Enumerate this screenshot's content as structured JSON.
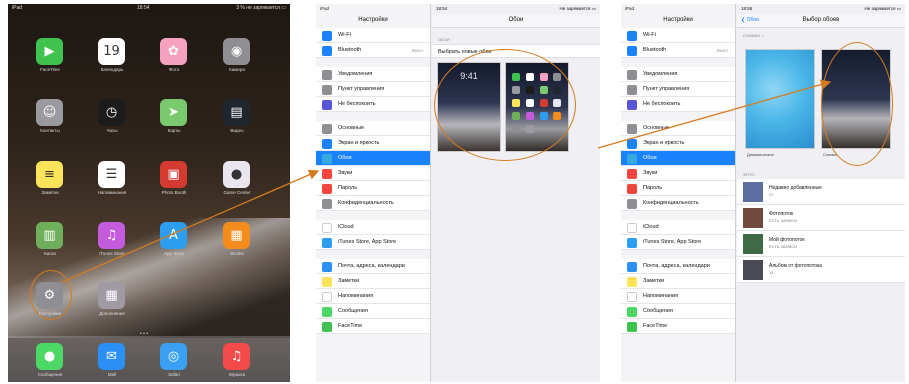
{
  "colors": {
    "accent": "#1a82fb",
    "annotation": "#d57b1e",
    "settings_bg": "#efeff4"
  },
  "home": {
    "status": {
      "left": "iPad",
      "center": "18:54",
      "right": "3 % не заряжается ▭"
    },
    "apps": [
      {
        "label": "FaceTime",
        "icon": "facetime-icon",
        "color": "#3fc24e",
        "glyph": "▶"
      },
      {
        "label": "Календарь",
        "icon": "calendar-icon",
        "color": "#ffffff",
        "glyph": "19"
      },
      {
        "label": "Фото",
        "icon": "photos-icon",
        "color": "#f6a1c0",
        "glyph": "✿"
      },
      {
        "label": "Камера",
        "icon": "camera-icon",
        "color": "#8e8e93",
        "glyph": "◉"
      },
      {
        "label": "Контакты",
        "icon": "contacts-icon",
        "color": "#9a9aa0",
        "glyph": "☺"
      },
      {
        "label": "Часы",
        "icon": "clock-icon",
        "color": "#1c1c1c",
        "glyph": "◷"
      },
      {
        "label": "Карты",
        "icon": "maps-icon",
        "color": "#7bc96f",
        "glyph": "➤"
      },
      {
        "label": "Видео",
        "icon": "videos-icon",
        "color": "#20262e",
        "glyph": "▤"
      },
      {
        "label": "Заметки",
        "icon": "notes-icon",
        "color": "#fbe45a",
        "glyph": "≡"
      },
      {
        "label": "Напоминания",
        "icon": "reminders-icon",
        "color": "#ffffff",
        "glyph": "☰"
      },
      {
        "label": "Photo Booth",
        "icon": "photobooth-icon",
        "color": "#d43a2f",
        "glyph": "▣"
      },
      {
        "label": "Game Center",
        "icon": "gamecenter-icon",
        "color": "#e9e6ef",
        "glyph": "●"
      },
      {
        "label": "Киоск",
        "icon": "newsstand-icon",
        "color": "#6fae5a",
        "glyph": "▥"
      },
      {
        "label": "iTunes Store",
        "icon": "itunes-icon",
        "color": "#c35bdc",
        "glyph": "♫"
      },
      {
        "label": "App Store",
        "icon": "appstore-icon",
        "color": "#2d9df0",
        "glyph": "A"
      },
      {
        "label": "iBooks",
        "icon": "ibooks-icon",
        "color": "#f38c1c",
        "glyph": "▦"
      },
      {
        "label": "Настройки",
        "icon": "settings-gear-icon",
        "color": "#8e8e93",
        "glyph": "⚙"
      },
      {
        "label": "Дополнения",
        "icon": "extras-folder-icon",
        "color": "#a09aa5",
        "glyph": "▦"
      }
    ],
    "dock": [
      {
        "label": "Сообщения",
        "icon": "messages-icon",
        "color": "#4bd865",
        "glyph": "●"
      },
      {
        "label": "Mail",
        "icon": "mail-icon",
        "color": "#2b8ff5",
        "glyph": "✉"
      },
      {
        "label": "Safari",
        "icon": "safari-icon",
        "color": "#3aa0f3",
        "glyph": "◎"
      },
      {
        "label": "Музыка",
        "icon": "music-icon",
        "color": "#f44a4a",
        "glyph": "♫"
      }
    ]
  },
  "settings2": {
    "status": {
      "left": "iPad",
      "center": "18:54",
      "right": "Не заряжается ▭"
    },
    "sidebar_title": "Настройки",
    "groups": [
      [
        {
          "label": "Wi-Fi",
          "icon": "wifi-icon",
          "color": "#1a82fb",
          "value": ""
        },
        {
          "label": "Bluetooth",
          "icon": "bluetooth-icon",
          "color": "#1a82fb",
          "value": "Выкл."
        }
      ],
      [
        {
          "label": "Уведомления",
          "icon": "notifications-icon",
          "color": "#8e8e93",
          "value": ""
        },
        {
          "label": "Пункт управления",
          "icon": "control-center-icon",
          "color": "#8e8e93",
          "value": ""
        },
        {
          "label": "Не беспокоить",
          "icon": "do-not-disturb-icon",
          "color": "#5856d6",
          "value": ""
        }
      ],
      [
        {
          "label": "Основные",
          "icon": "general-icon",
          "color": "#8e8e93",
          "value": ""
        },
        {
          "label": "Экран и яркость",
          "icon": "display-icon",
          "color": "#1a82fb",
          "value": ""
        },
        {
          "label": "Обои",
          "icon": "wallpaper-icon",
          "color": "#35aadc",
          "value": "",
          "selected": true
        },
        {
          "label": "Звуки",
          "icon": "sounds-icon",
          "color": "#f2453d",
          "value": ""
        },
        {
          "label": "Пароль",
          "icon": "passcode-icon",
          "color": "#f2453d",
          "value": ""
        },
        {
          "label": "Конфиденциальность",
          "icon": "privacy-icon",
          "color": "#8e8e93",
          "value": ""
        }
      ],
      [
        {
          "label": "iCloud",
          "icon": "icloud-icon",
          "color": "#ffffff",
          "value": ""
        },
        {
          "label": "iTunes Store, App Store",
          "icon": "appstore-small-icon",
          "color": "#2d9df0",
          "value": ""
        }
      ],
      [
        {
          "label": "Почта, адреса, календари",
          "icon": "mail-contacts-icon",
          "color": "#2b8ff5",
          "value": ""
        },
        {
          "label": "Заметки",
          "icon": "notes-small-icon",
          "color": "#fbe45a",
          "value": ""
        },
        {
          "label": "Напоминания",
          "icon": "reminders-small-icon",
          "color": "#ffffff",
          "value": ""
        },
        {
          "label": "Сообщения",
          "icon": "messages-small-icon",
          "color": "#4bd865",
          "value": ""
        },
        {
          "label": "FaceTime",
          "icon": "facetime-small-icon",
          "color": "#3fc24e",
          "value": ""
        }
      ]
    ],
    "detail": {
      "title": "Обои",
      "section_caption": "ОБОИ",
      "choose_label": "Выбрать новые обои",
      "lock_time": "9:41"
    }
  },
  "settings3": {
    "status": {
      "left": "iPad",
      "center": "18:55",
      "right": "Не заряжается ▭"
    },
    "sidebar_title": "Настройки",
    "detail": {
      "back_label": "❮ Обои",
      "title": "Выбор обоев",
      "section_caption": "СНИМКИ ✓",
      "dynamic_label": "Динамические",
      "still_label": "Снимки",
      "photos_caption": "ФОТО",
      "albums": [
        {
          "name": "Недавно добавленные",
          "count": "27",
          "color": "#5b6fa0"
        },
        {
          "name": "Фотопоток",
          "count": "ЕСТЬ ЗАПИСИ",
          "color": "#6f4a3d"
        },
        {
          "name": "Мой фотопоток",
          "count": "ЕСТЬ ЗАПИСИ",
          "color": "#3f6a45"
        },
        {
          "name": "Альбом от фотопотока",
          "count": "14",
          "color": "#4a4a56"
        }
      ]
    }
  }
}
